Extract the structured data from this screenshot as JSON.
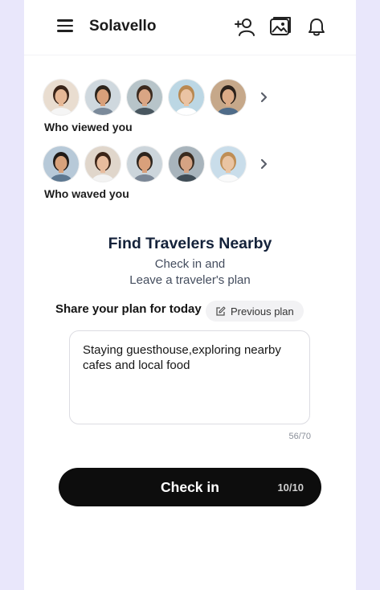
{
  "app": {
    "title": "Solavello"
  },
  "header": {
    "icons": [
      "menu-icon",
      "add-friend-icon",
      "photo-album-icon",
      "bell-icon"
    ]
  },
  "viewed": {
    "label": "Who viewed you",
    "avatars": [
      {
        "name": "avatar-1",
        "skin": "#e6b896",
        "hair": "#3a2418",
        "bg": "#e9ddd0",
        "shirt": "#f5f5f5"
      },
      {
        "name": "avatar-2",
        "skin": "#d8a07a",
        "hair": "#2c241c",
        "bg": "#cfd8de",
        "shirt": "#7b8a9a"
      },
      {
        "name": "avatar-3",
        "skin": "#d9a584",
        "hair": "#3b2a1f",
        "bg": "#b7c4c9",
        "shirt": "#48565f"
      },
      {
        "name": "avatar-4",
        "skin": "#eac3a3",
        "hair": "#b98850",
        "bg": "#bcd7e4",
        "shirt": "#ffffff"
      },
      {
        "name": "avatar-5",
        "skin": "#dcab87",
        "hair": "#2b211a",
        "bg": "#c6a88a",
        "shirt": "#4f6c89"
      }
    ]
  },
  "waved": {
    "label": "Who waved you",
    "avatars": [
      {
        "name": "avatar-6",
        "skin": "#d7a27c",
        "hair": "#1f1a17",
        "bg": "#b7c9d8",
        "shirt": "#5d7891"
      },
      {
        "name": "avatar-7",
        "skin": "#e8bc9d",
        "hair": "#3b2417",
        "bg": "#e0d6cb",
        "shirt": "#f3f3f3"
      },
      {
        "name": "avatar-8",
        "skin": "#d9a07b",
        "hair": "#2d241d",
        "bg": "#ccd5db",
        "shirt": "#7b8796"
      },
      {
        "name": "avatar-9",
        "skin": "#d5a383",
        "hair": "#3a2b1f",
        "bg": "#a8b4bc",
        "shirt": "#3f4c55"
      },
      {
        "name": "avatar-10",
        "skin": "#eac4a2",
        "hair": "#bf8e55",
        "bg": "#c9ddea",
        "shirt": "#fafafa"
      }
    ]
  },
  "find": {
    "title": "Find Travelers Nearby",
    "line1": "Check in and",
    "line2": "Leave a traveler's plan"
  },
  "plan": {
    "label": "Share your plan for today",
    "previous_label": "Previous plan",
    "text": "Staying guesthouse,exploring nearby cafes and local food",
    "counter": "56/70"
  },
  "checkin": {
    "label": "Check in",
    "count": "10/10"
  }
}
